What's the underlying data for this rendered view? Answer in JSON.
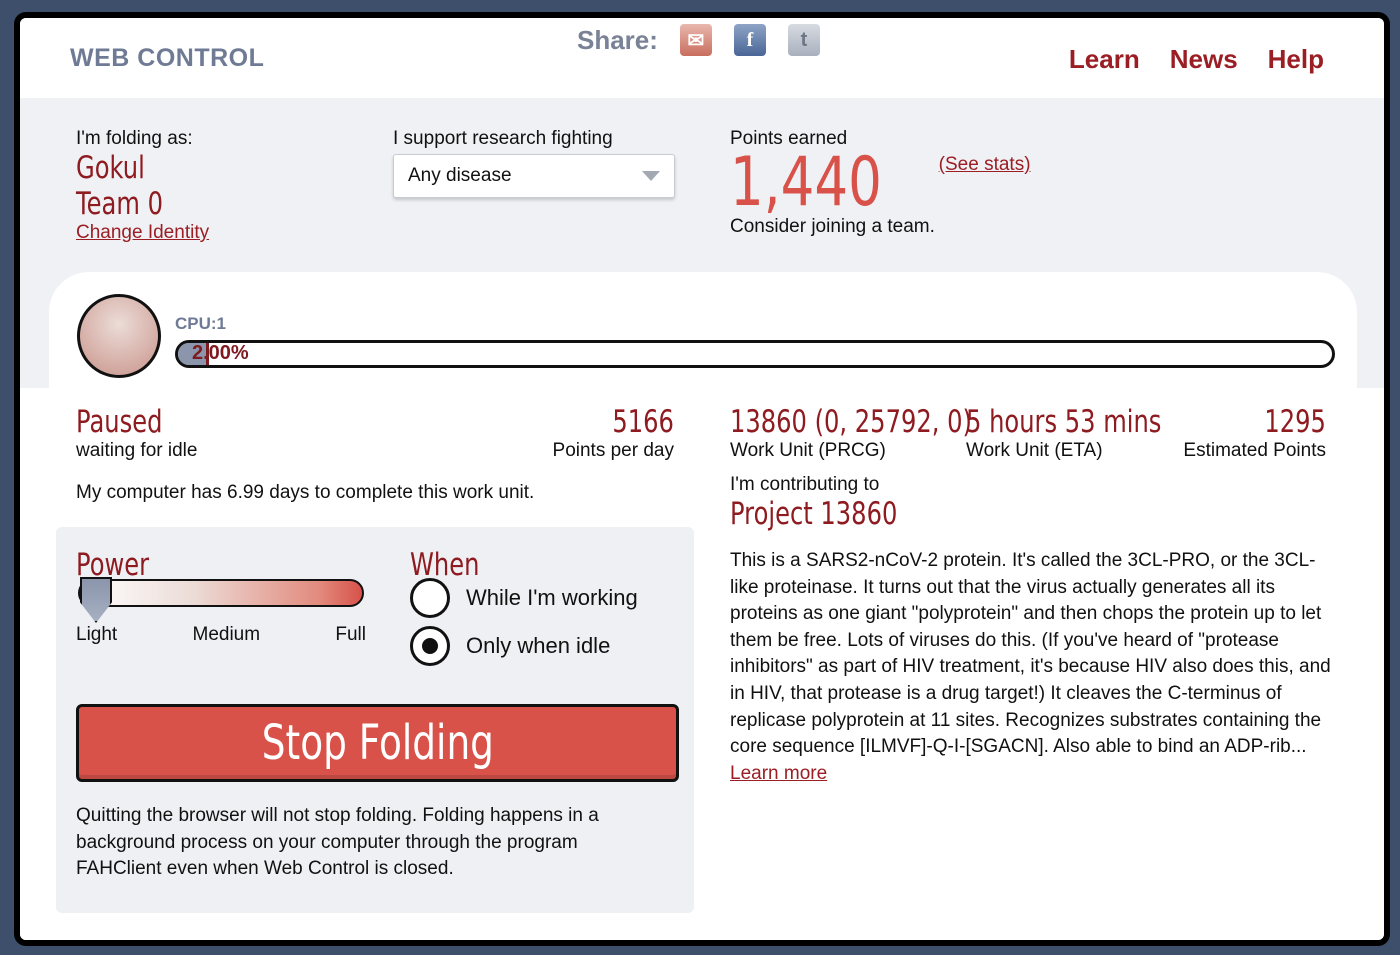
{
  "header": {
    "brand": "WEB CONTROL",
    "share_label": "Share:",
    "share_icons": [
      "mail-icon",
      "facebook-icon",
      "twitter-icon"
    ],
    "nav": [
      "Learn",
      "News",
      "Help"
    ]
  },
  "identity": {
    "label": "I'm folding as:",
    "user": "Gokul",
    "team": "Team 0",
    "change": "Change Identity"
  },
  "support": {
    "label": "I support research fighting",
    "selected": "Any disease"
  },
  "points": {
    "label": "Points earned",
    "value": "1,440",
    "see_stats": "(See stats)",
    "consider": "Consider joining a team."
  },
  "cpu": {
    "label": "CPU:1",
    "progress_text": "2.00%",
    "progress": 0.02
  },
  "status": {
    "state": "Paused",
    "reason": "waiting for idle",
    "ppd_value": "5166",
    "ppd_label": "Points per day",
    "days_text": "My computer has 6.99 days to complete this work unit."
  },
  "work_unit": {
    "prcg": "13860 (0, 25792, 0)",
    "prcg_label": "Work Unit (PRCG)",
    "eta": "5 hours 53 mins",
    "eta_label": "Work Unit (ETA)",
    "est_points": "1295",
    "est_label": "Estimated Points"
  },
  "project": {
    "contributing": "I'm contributing to",
    "name": "Project 13860",
    "description": "This is a SARS2-nCoV-2 protein. It's called the 3CL-PRO, or the 3CL-like proteinase. It turns out that the virus actually generates all its proteins as one giant \"polyprotein\" and then chops the protein up to let them be free. Lots of viruses do this. (If you've heard of \"protease inhibitors\" as part of HIV treatment, it's because HIV also does this, and in HIV, that protease is a drug target!) It cleaves the C-terminus of replicase polyprotein at 11 sites. Recognizes substrates containing the core sequence [ILMVF]-Q-I-[SGACN]. Also able to bind an ADP-rib...",
    "learn_more": "Learn more"
  },
  "controls": {
    "power_title": "Power",
    "power_level": "Light",
    "power_labels": [
      "Light",
      "Medium",
      "Full"
    ],
    "when_title": "When",
    "when_options": [
      "While I'm working",
      "Only when idle"
    ],
    "when_selected": "Only when idle",
    "stop_button": "Stop Folding",
    "note": "Quitting the browser will not stop folding. Folding happens in a background process on your computer through the program FAHClient even when Web Control is closed."
  },
  "colors": {
    "accent_dark_red": "#8e1b20",
    "accent_red": "#d8524a",
    "brand_gray": "#6f7a94"
  }
}
